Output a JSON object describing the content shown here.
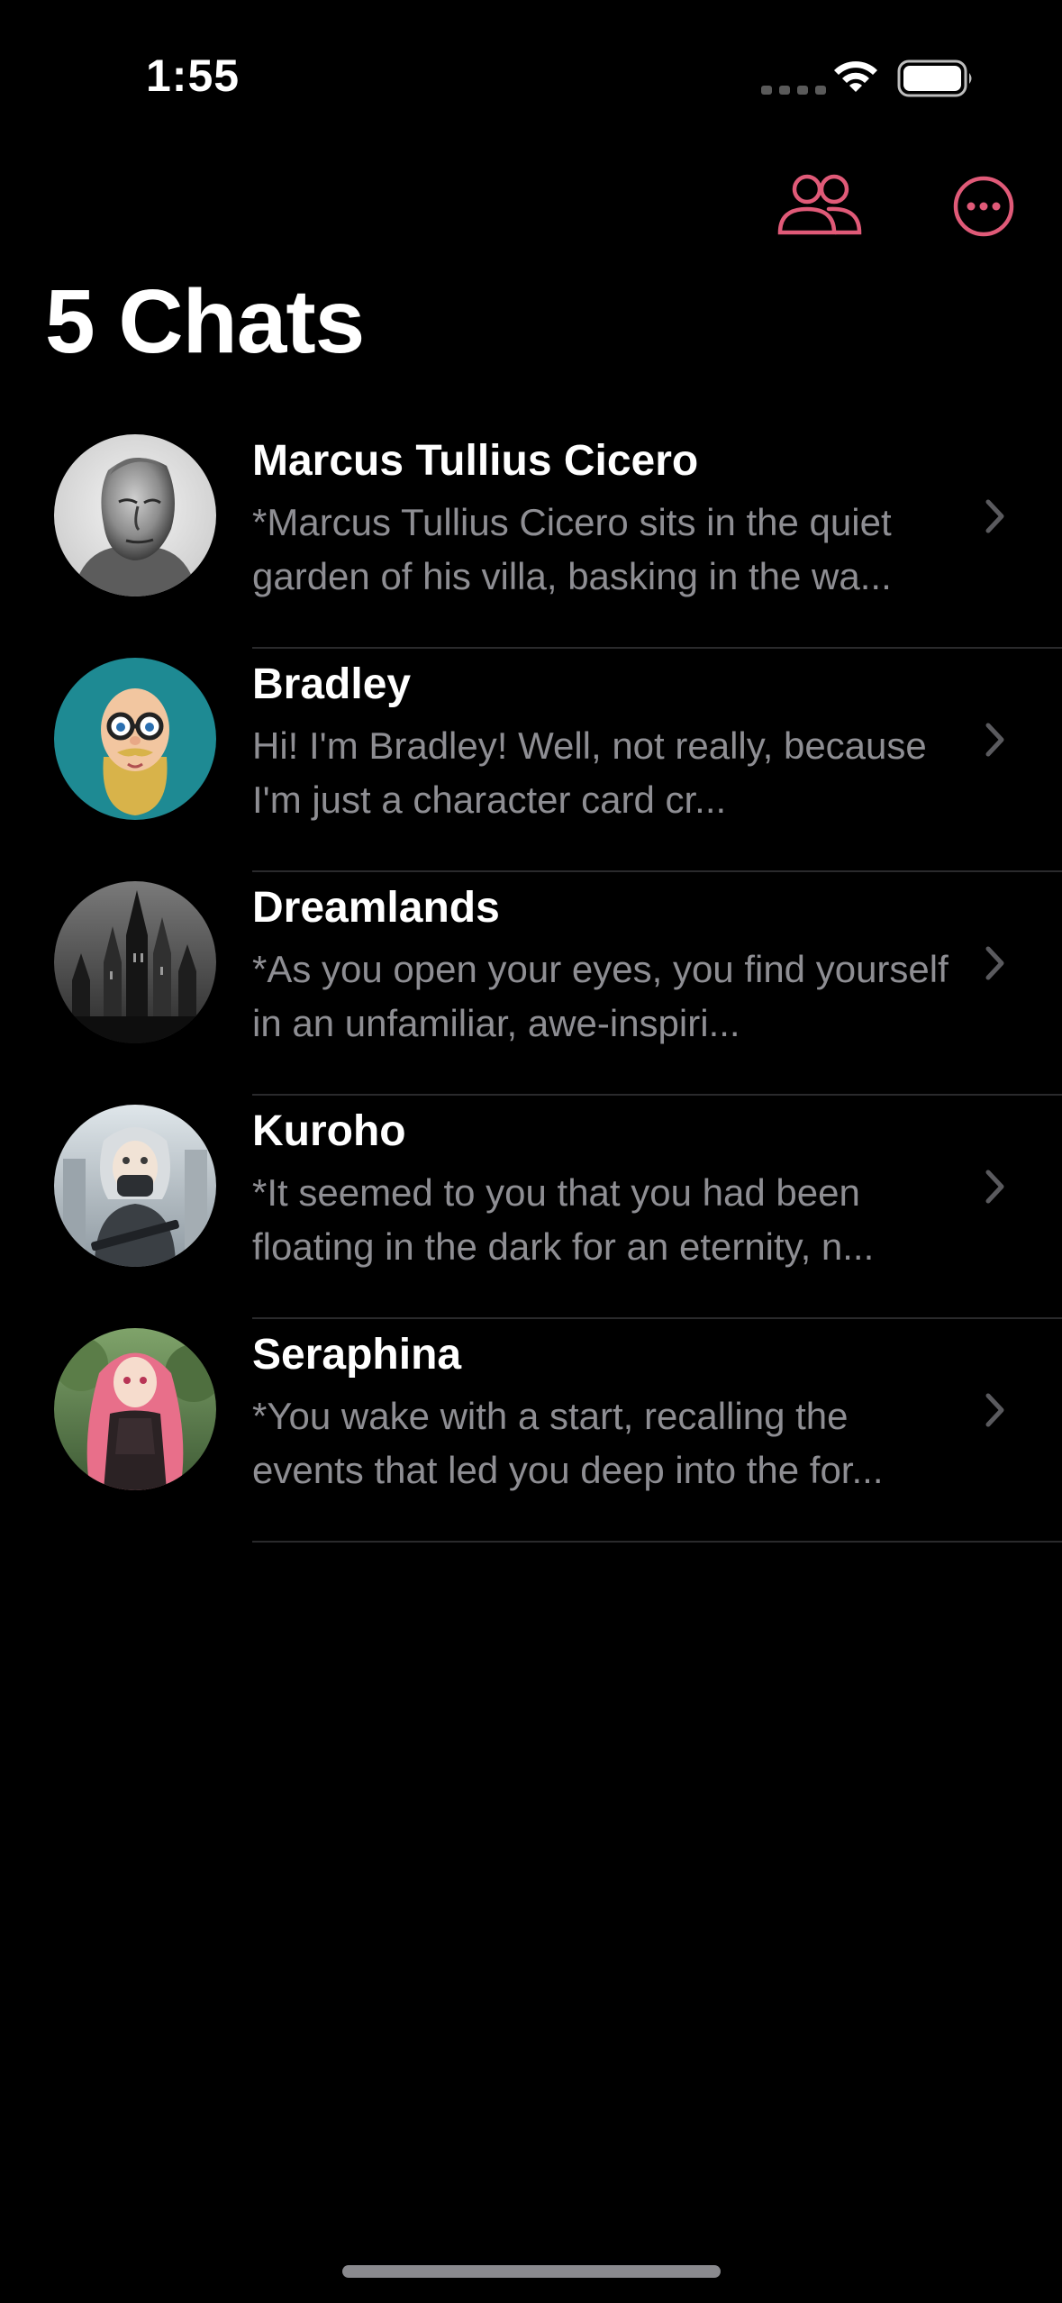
{
  "status_bar": {
    "time": "1:55"
  },
  "toolbar": {
    "people_icon": "people-icon",
    "more_icon": "ellipsis-circle-icon"
  },
  "colors": {
    "accent": "#e05a78",
    "background": "#000000",
    "secondary_text": "#8e8e93",
    "separator": "#2a2a2c"
  },
  "header": {
    "title": "5 Chats"
  },
  "chats": [
    {
      "name": "Marcus Tullius Cicero",
      "preview": "*Marcus Tullius Cicero sits in the quiet garden of his villa, basking in the wa...",
      "avatar": "marble-bust-avatar"
    },
    {
      "name": "Bradley",
      "preview": "Hi! I'm Bradley! Well, not really, because I'm just a character card cr...",
      "avatar": "cartoon-man-avatar"
    },
    {
      "name": "Dreamlands",
      "preview": "*As you open your eyes, you find yourself in an unfamiliar, awe-inspiri...",
      "avatar": "gothic-city-avatar"
    },
    {
      "name": "Kuroho",
      "preview": "*It seemed to you that you had been floating in the dark for an eternity, n...",
      "avatar": "armored-girl-avatar"
    },
    {
      "name": "Seraphina",
      "preview": "*You wake with a start, recalling the events that led you deep into the for...",
      "avatar": "forest-girl-avatar"
    }
  ]
}
